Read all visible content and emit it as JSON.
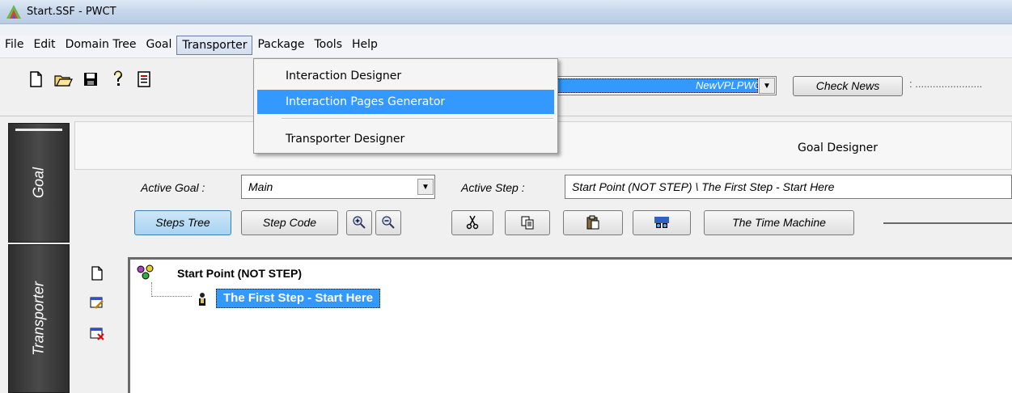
{
  "window": {
    "title": "Start.SSF  - PWCT"
  },
  "menubar": {
    "items": [
      "File",
      "Edit",
      "Domain Tree",
      "Goal",
      "Transporter",
      "Package",
      "Tools",
      "Help"
    ],
    "active": "Transporter"
  },
  "toolbar": {
    "icons": [
      "new-file-icon",
      "open-folder-icon",
      "save-disk-icon",
      "help-key-icon",
      "form-icon"
    ],
    "news_source": "NewVPLPWCT",
    "check_news_label": "Check News",
    "trailing_text": ": ......................."
  },
  "transporter_menu": {
    "items": [
      "Interaction Designer",
      "Interaction Pages Generator",
      "Transporter Designer"
    ],
    "highlighted": "Interaction Pages Generator"
  },
  "sidebar": {
    "tabs": [
      "Goal",
      "Transporter"
    ]
  },
  "goal_designer": {
    "header": "Goal Designer",
    "active_goal_label": "Active Goal :",
    "active_goal_value": "Main",
    "active_step_label": "Active Step :",
    "active_step_value": "Start Point (NOT STEP)  \\  The First Step  - Start Here",
    "buttons": {
      "steps_tree": "Steps Tree",
      "step_code": "Step Code",
      "time_machine": "The Time Machine"
    },
    "tool_icons": [
      "zoom-in-icon",
      "zoom-out-icon",
      "cut-icon",
      "copy-icon",
      "paste-icon",
      "find-icon"
    ]
  },
  "tree": {
    "root": "Start Point (NOT STEP)",
    "child": "The First Step  - Start Here"
  },
  "colors": {
    "selection": "#3399ff",
    "sidebar_tab": "#3b3b3b"
  }
}
